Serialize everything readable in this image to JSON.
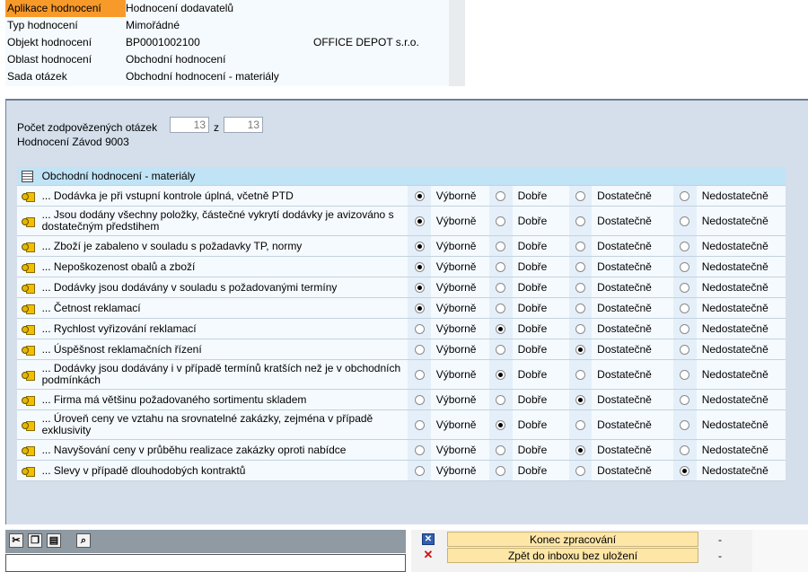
{
  "header": {
    "rows": [
      {
        "label": "Aplikace hodnocení",
        "value": "Hodnocení dodavatelů",
        "value2": "",
        "selected": true
      },
      {
        "label": "Typ hodnocení",
        "value": "Mimořádné",
        "value2": "",
        "selected": false
      },
      {
        "label": "Objekt hodnocení",
        "value": "BP0001002100",
        "value2": "OFFICE DEPOT s.r.o.",
        "selected": false
      },
      {
        "label": "Oblast hodnocení",
        "value": "Obchodní hodnocení",
        "value2": "",
        "selected": false
      },
      {
        "label": "Sada otázek",
        "value": "Obchodní hodnocení - materiály",
        "value2": "",
        "selected": false
      }
    ]
  },
  "summary": {
    "count_label": "Počet zodpovězených otázek",
    "answered": "13",
    "of_label": "z",
    "total": "13",
    "plant": "Hodnocení Závod 9003"
  },
  "questions_table": {
    "title": "Obchodní hodnocení - materiály",
    "options": [
      "Výborně",
      "Dobře",
      "Dostatečně",
      "Nedostatečně"
    ],
    "rows": [
      {
        "text": "... Dodávka je při vstupní kontrole úplná, včetně PTD",
        "selected": 0
      },
      {
        "text": "... Jsou dodány všechny položky, částečné vykrytí dodávky je avizováno s dostatečným předstihem",
        "selected": 0
      },
      {
        "text": "... Zboží je zabaleno v souladu s požadavky TP, normy",
        "selected": 0
      },
      {
        "text": "... Nepoškozenost obalů a zboží",
        "selected": 0
      },
      {
        "text": "... Dodávky jsou dodávány v souladu s požadovanými termíny",
        "selected": 0
      },
      {
        "text": "... Četnost reklamací",
        "selected": 0
      },
      {
        "text": "... Rychlost vyřizování reklamací",
        "selected": 1
      },
      {
        "text": "... Úspěšnost reklamačních řízení",
        "selected": 2
      },
      {
        "text": "... Dodávky jsou dodávány i v případě termínů kratších než je v obchodních podmínkách",
        "selected": 1
      },
      {
        "text": "... Firma má většinu požadovaného sortimentu skladem",
        "selected": 2
      },
      {
        "text": "... Úroveň ceny ve vztahu na srovnatelné zakázky, zejména v případě exklusivity",
        "selected": 1
      },
      {
        "text": "... Navyšování ceny v průběhu realizace zakázky oproti nabídce",
        "selected": 2
      },
      {
        "text": "... Slevy v případě dlouhodobých kontraktů",
        "selected": 3
      }
    ]
  },
  "toolbar": {
    "icons": [
      "cut-icon",
      "copy-icon",
      "paste-icon",
      "find-icon"
    ]
  },
  "actions": [
    {
      "icon": "close-blue-icon",
      "label": "Konec zpracování",
      "status": "-"
    },
    {
      "icon": "cancel-red-icon",
      "label": "Zpět do inboxu bez uložení",
      "status": "-"
    }
  ],
  "colors": {
    "selected_label": "#f79a2a",
    "panel": "#d4dfeb",
    "table_header": "#c1e3f6",
    "button": "#fde6a6"
  }
}
